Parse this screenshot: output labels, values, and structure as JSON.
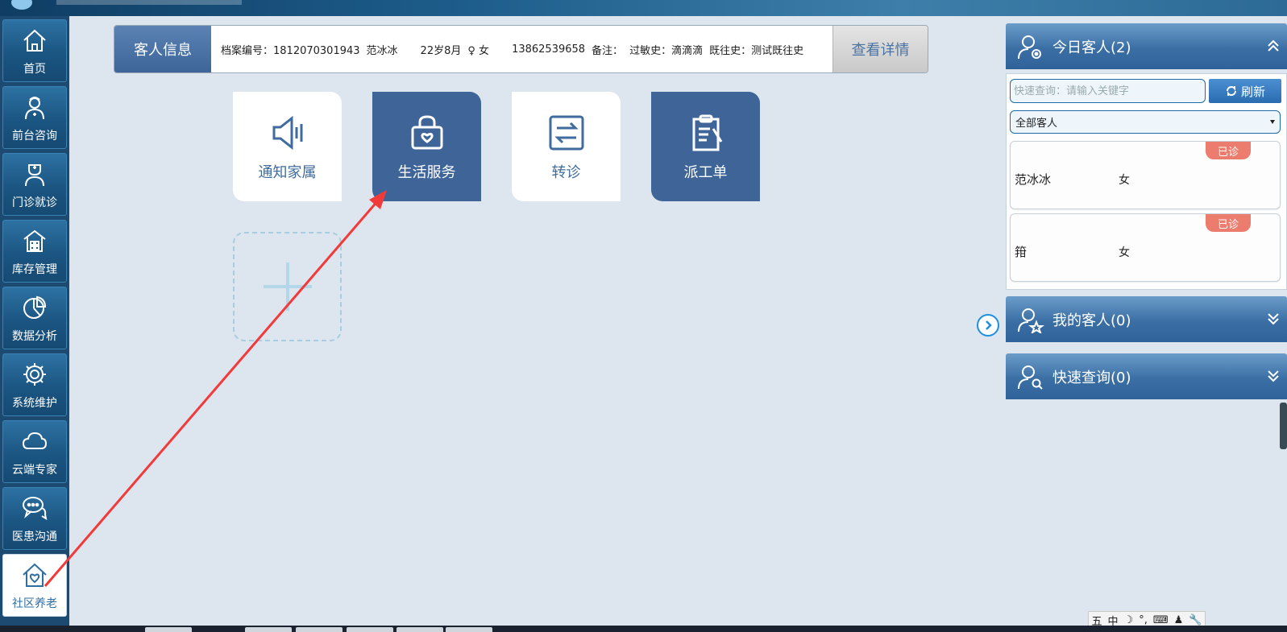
{
  "sidebar": {
    "items": [
      {
        "label": "首页",
        "icon": "home-icon"
      },
      {
        "label": "前台咨询",
        "icon": "nurse-icon"
      },
      {
        "label": "门诊就诊",
        "icon": "doctor-icon"
      },
      {
        "label": "库存管理",
        "icon": "warehouse-icon"
      },
      {
        "label": "数据分析",
        "icon": "pie-chart-icon"
      },
      {
        "label": "系统维护",
        "icon": "gear-icon"
      },
      {
        "label": "云端专家",
        "icon": "cloud-icon"
      },
      {
        "label": "医患沟通",
        "icon": "chat-icon"
      },
      {
        "label": "社区养老",
        "icon": "house-heart-icon"
      }
    ],
    "active_index": 8
  },
  "info_bar": {
    "label": "客人信息",
    "record_no": "档案编号：1812070301943",
    "name": "范冰冰",
    "age": "22岁8月",
    "gender_symbol": "♀",
    "gender": "女",
    "phone": "13862539658",
    "remark_label": "备注：",
    "allergy": "过敏史：滴滴滴",
    "history": "既往史：测试既往史",
    "details_button": "查看详情"
  },
  "tiles": [
    {
      "label": "通知家属",
      "icon": "speaker-icon",
      "style": "light"
    },
    {
      "label": "生活服务",
      "icon": "shopping-bag-heart-icon",
      "style": "dark"
    },
    {
      "label": "转诊",
      "icon": "transfer-arrows-icon",
      "style": "light"
    },
    {
      "label": "派工单",
      "icon": "clipboard-icon",
      "style": "dark"
    }
  ],
  "right_panel": {
    "today": {
      "title": "今日客人(2)",
      "search_placeholder": "快速查询：请输入关键字",
      "refresh_label": "刷新",
      "filter_selected": "全部客人",
      "customers": [
        {
          "name": "范冰冰",
          "gender": "女",
          "status": "已诊"
        },
        {
          "name": "箝",
          "gender": "女",
          "status": "已诊"
        }
      ]
    },
    "mine": {
      "title": "我的客人(0)"
    },
    "quick": {
      "title": "快速查询(0)"
    }
  },
  "ime": {
    "items": [
      "五",
      "中",
      "☽",
      "°,",
      "⌨",
      "♟",
      "🔧"
    ]
  },
  "colors": {
    "accent_blue": "#3e6498",
    "sidebar_bg": "#1c4a70",
    "badge_red": "#ec7d6e",
    "annotation_arrow": "#f23a3a"
  }
}
